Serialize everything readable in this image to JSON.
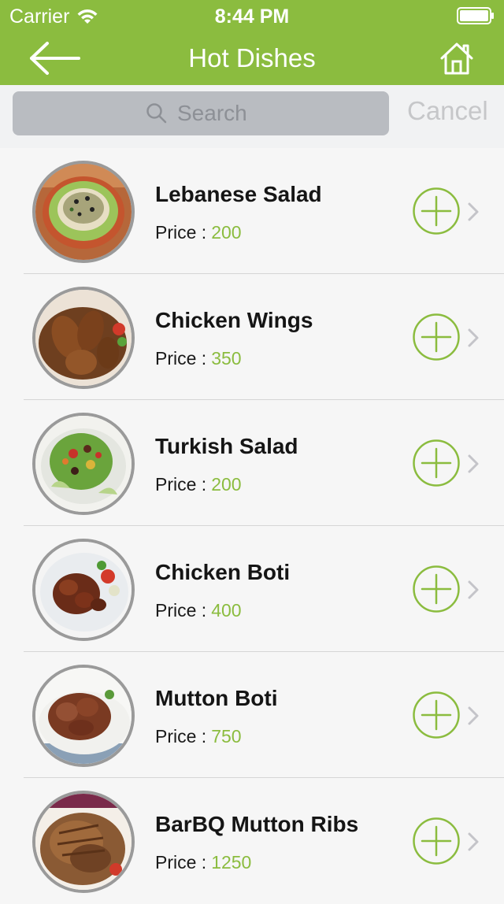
{
  "status_bar": {
    "carrier": "Carrier",
    "time": "8:44 PM"
  },
  "navbar": {
    "title": "Hot Dishes",
    "back_icon": "back-arrow-icon",
    "home_icon": "home-icon"
  },
  "search": {
    "placeholder": "Search",
    "cancel_label": "Cancel"
  },
  "colors": {
    "accent": "#8bbc3f",
    "search_bg": "#b9bcc1",
    "list_bg": "#f6f6f6"
  },
  "items": [
    {
      "name": "Lebanese Salad",
      "price_label": "Price :",
      "price": "200",
      "image": "salad-bowl"
    },
    {
      "name": "Chicken Wings",
      "price_label": "Price :",
      "price": "350",
      "image": "chicken-wings"
    },
    {
      "name": "Turkish Salad",
      "price_label": "Price :",
      "price": "200",
      "image": "mixed-salad"
    },
    {
      "name": "Chicken Boti",
      "price_label": "Price :",
      "price": "400",
      "image": "grilled-chicken"
    },
    {
      "name": "Mutton Boti",
      "price_label": "Price :",
      "price": "750",
      "image": "mutton-chunks"
    },
    {
      "name": "BarBQ Mutton Ribs",
      "price_label": "Price :",
      "price": "1250",
      "image": "bbq-ribs"
    }
  ]
}
